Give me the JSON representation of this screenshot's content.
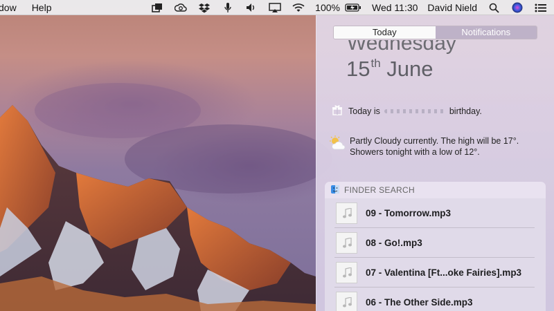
{
  "menubar": {
    "menus": [
      "dow",
      "Help"
    ],
    "battery": "100%",
    "clock": "Wed 11:30",
    "user": "David Nield",
    "icons": [
      "screen-capture-icon",
      "creative-cloud-icon",
      "dropbox-icon",
      "microphone-icon",
      "volume-icon",
      "airplay-icon",
      "wifi-icon",
      "battery-icon",
      "spotlight-icon",
      "siri-icon",
      "notification-center-icon"
    ]
  },
  "notification_center": {
    "tabs": [
      {
        "label": "Today",
        "active": true
      },
      {
        "label": "Notifications",
        "active": false
      }
    ],
    "date": {
      "weekday": "Wednesday",
      "day": "15",
      "suffix": "th",
      "month": "June"
    },
    "birthday": {
      "prefix": "Today is",
      "suffix": "birthday."
    },
    "weather": {
      "line1": "Partly Cloudy currently. The high will be 17°.",
      "line2": "Showers tonight with a low of 12°."
    },
    "finder_search": {
      "title": "FINDER SEARCH",
      "results": [
        {
          "name": "09 - Tomorrow.mp3"
        },
        {
          "name": "08 - Go!.mp3"
        },
        {
          "name": "07 - Valentina [Ft...oke Fairies].mp3"
        },
        {
          "name": "06 - The Other Side.mp3"
        }
      ]
    }
  }
}
